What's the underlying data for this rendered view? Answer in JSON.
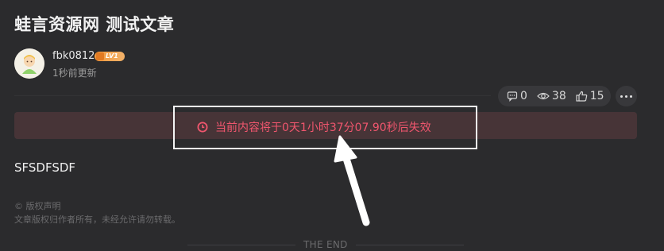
{
  "article": {
    "title": "蛙言资源网 测试文章",
    "author": "fbk0812",
    "level": "LV1",
    "updated": "1秒前更新",
    "content": "SFSDFSDF"
  },
  "stats": {
    "comments": "0",
    "views": "38",
    "likes": "15"
  },
  "notice": {
    "text": "当前内容将于0天1小时37分07.90秒后失效",
    "color": "#f0566e",
    "icon": "clock-icon"
  },
  "copyright": {
    "title": "© 版权声明",
    "body": "文章版权归作者所有，未经允许请勿转载。"
  },
  "footer": {
    "the_end": "THE END"
  },
  "icons": {
    "comments": "comment-icon",
    "views": "eye-icon",
    "likes": "thumbs-up-icon",
    "more": "more-icon"
  }
}
